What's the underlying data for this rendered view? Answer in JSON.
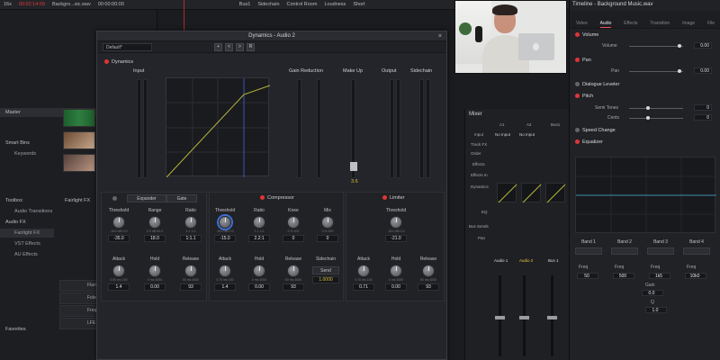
{
  "topbar": {
    "items": [
      "16x",
      "00:02:14:09",
      "Backgro...sic.wav",
      "00:00:00:00",
      "Bus1",
      "Sidechain",
      "Control Room",
      "Loudness",
      "Short"
    ],
    "accent": "#e03b3b"
  },
  "left_panel": {
    "master_label": "Master",
    "smart_bins_label": "Smart Bins",
    "keywords_label": "Keywords",
    "thumb_labels": [
      "Background Mu...",
      "Interview 1..."
    ],
    "toolbox_items": [
      {
        "label": "Toolbox"
      },
      {
        "label": "Audio Transitions"
      },
      {
        "label": "Audio FX"
      },
      {
        "label": "Fairlight FX",
        "selected": true
      },
      {
        "label": "VST Effects"
      },
      {
        "label": "AU Effects"
      }
    ],
    "fairlight_header": "Fairlight FX",
    "fx_items": [
      "Flanger",
      "Foley Sampler",
      "Frequency Analyzer",
      "LFE Filter"
    ],
    "favorites_label": "Favorites"
  },
  "plugin": {
    "title": "Dynamics - Audio 2",
    "preset": "Default*",
    "preset_buttons": [
      "+",
      "<",
      ">",
      "R"
    ],
    "dynamics_label": "Dynamics",
    "columns": {
      "input": "Input",
      "gain_reduction": "Gain Reduction",
      "make_up": "Make Up",
      "output": "Output",
      "sidechain": "Sidechain"
    },
    "makeup_value": "3.6",
    "input_scale": [
      "0",
      "-6",
      "-12",
      "-18",
      "-24",
      "-30",
      "-36",
      "-42",
      "-48",
      "-54",
      "-60"
    ],
    "gr_scale": [
      "0",
      "-3",
      "-6",
      "-9",
      "-12",
      "-15",
      "-18",
      "-21",
      "-24",
      "-27",
      "-30"
    ],
    "mu_scale": [
      "+24",
      "+21",
      "+18",
      "+15",
      "+12",
      "+9",
      "+6",
      "+3",
      "0"
    ],
    "graph_axis": [
      "-60",
      "-48",
      "-36",
      "-24",
      "-12",
      "0"
    ],
    "expander": {
      "tab_expander": "Expander",
      "tab_gate": "Gate",
      "knobs": [
        {
          "label": "Threshold",
          "value": "-35.0",
          "range": "-90.0 dB 0.0"
        },
        {
          "label": "Range",
          "value": "18.0",
          "range": "0.0 dB 60.0"
        },
        {
          "label": "Ratio",
          "value": "1:1.1",
          "range": "1.1 1.3"
        },
        {
          "label": "Attack",
          "value": "1.4",
          "range": "0.00 ms 100"
        },
        {
          "label": "Hold",
          "value": "0.00",
          "range": "0 ms 4000"
        },
        {
          "label": "Release",
          "value": "93",
          "range": "50 ms 4000"
        }
      ]
    },
    "compressor": {
      "title": "Compressor",
      "knobs": [
        {
          "label": "Threshold",
          "value": "-15.0",
          "range": "-50.0 dB 0.0"
        },
        {
          "label": "Ratio",
          "value": "2.2:1",
          "range": "1.1 1.0"
        },
        {
          "label": "Knee",
          "value": "0",
          "range": "0 % 100"
        },
        {
          "label": "Mix",
          "value": "0",
          "range": "0 % 100"
        },
        {
          "label": "Attack",
          "value": "1.4",
          "range": "0.70 ms 100"
        },
        {
          "label": "Hold",
          "value": "0.00",
          "range": "0 ms 4000"
        },
        {
          "label": "Release",
          "value": "93",
          "range": "50 ms 4000"
        }
      ],
      "sidechain_label": "Sidechain",
      "send_label": "Send",
      "send_value": "1.0000"
    },
    "limiter": {
      "title": "Limiter",
      "knobs": [
        {
          "label": "Threshold",
          "value": "-21.0",
          "range": "-30.0 dB 0.0"
        },
        {
          "label": "Attack",
          "value": "0.71",
          "range": "0.70 ms 100"
        },
        {
          "label": "Hold",
          "value": "0.00",
          "range": "0 ms 4000"
        },
        {
          "label": "Release",
          "value": "93",
          "range": "50 ms 4000"
        }
      ]
    }
  },
  "mixer": {
    "title": "Mixer",
    "columns": [
      "A1",
      "A2",
      "Bus1"
    ],
    "row_labels": [
      "Input",
      "Track FX",
      "Order",
      "Effects",
      "Effects In",
      "Dynamics",
      "EQ",
      "Bus Sends",
      "Pan"
    ],
    "input_values": [
      "No Input",
      "No Input"
    ],
    "channel_labels": [
      "Audio 1",
      "Audio 2",
      "Bus 1"
    ]
  },
  "inspector": {
    "title": "Timeline - Background Music.wav",
    "tabs": [
      "Video",
      "Audio",
      "Effects",
      "Transition",
      "Image",
      "File"
    ],
    "active_tab": "Audio",
    "volume_label": "Volume",
    "volume_sub": "Volume",
    "volume_value": "0.00",
    "pan_label": "Pan",
    "pan_sub": "Pan",
    "pan_value": "0.00",
    "dialogue_leveler": "Dialogue Leveler",
    "pitch_label": "Pitch",
    "semitones_label": "Semi Tones",
    "semitones_value": "0",
    "cents_label": "Cents",
    "cents_value": "0",
    "speed_change": "Speed Change",
    "equalizer": "Equalizer",
    "bands": [
      "Band 1",
      "Band 2",
      "Band 3",
      "Band 4"
    ],
    "freq_label": "Freq",
    "freq_values": [
      "50",
      "500",
      "1k5",
      "10k0"
    ],
    "gain_label": "Gain",
    "gain_value": "0.0",
    "q_label": "Q",
    "q_value": "1.0"
  }
}
